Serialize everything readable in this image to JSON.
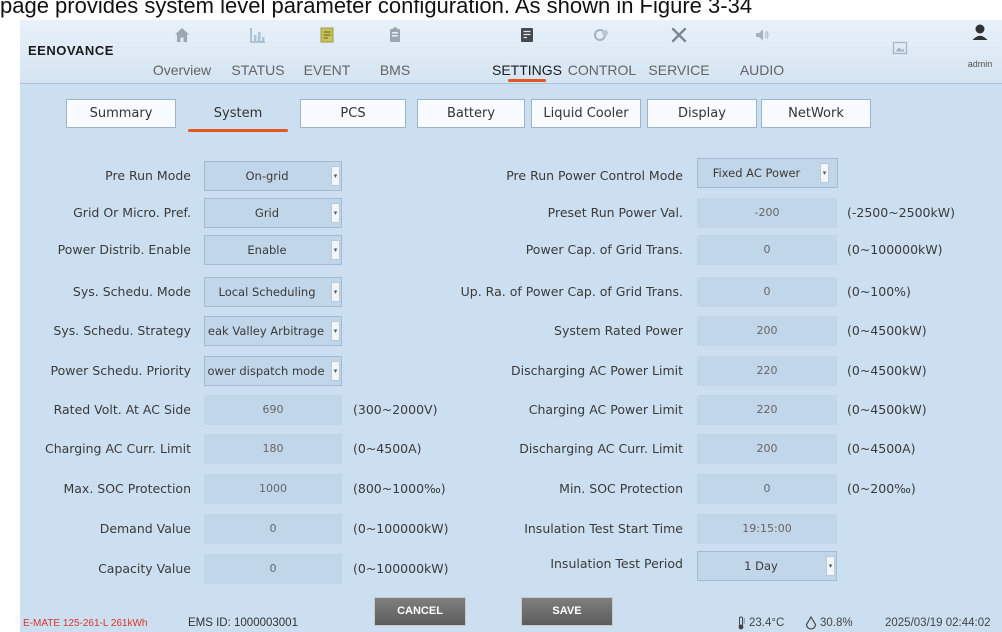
{
  "caption": "page provides system level parameter configuration. As shown in Figure 3-34",
  "logo": "EENOVANCE",
  "nav": [
    {
      "label": "Overview",
      "icon": "home-icon"
    },
    {
      "label": "STATUS",
      "icon": "bar-chart-icon"
    },
    {
      "label": "EVENT",
      "icon": "event-icon"
    },
    {
      "label": "BMS",
      "icon": "battery-icon"
    },
    {
      "label": "SETTINGS",
      "icon": "settings-doc-icon"
    },
    {
      "label": "CONTROL",
      "icon": "control-icon"
    },
    {
      "label": "SERVICE",
      "icon": "service-tools-icon"
    },
    {
      "label": "AUDIO",
      "icon": "speaker-icon"
    },
    {
      "label": "",
      "icon": "screenshot-icon"
    },
    {
      "label": "admin",
      "icon": "user-avatar-icon"
    }
  ],
  "tabs": [
    "Summary",
    "System",
    "PCS",
    "Battery",
    "Liquid Cooler",
    "Display",
    "NetWork"
  ],
  "left": [
    {
      "label": "Pre Run Mode",
      "value": "On-grid"
    },
    {
      "label": "Grid Or Micro. Pref.",
      "value": "Grid"
    },
    {
      "label": "Power Distrib. Enable",
      "value": "Enable"
    },
    {
      "label": "Sys. Schedu. Mode",
      "value": "Local Scheduling"
    },
    {
      "label": "Sys. Schedu. Strategy",
      "value": "eak Valley Arbitrage"
    },
    {
      "label": "Power Schedu. Priority",
      "value": "ower dispatch mode"
    },
    {
      "label": "Rated Volt. At AC Side",
      "value": "690",
      "range": "(300~2000V)"
    },
    {
      "label": "Charging AC Curr. Limit",
      "value": "180",
      "range": "(0~4500A)"
    },
    {
      "label": "Max. SOC Protection",
      "value": "1000",
      "range": "(800~1000‰)"
    },
    {
      "label": "Demand Value",
      "value": "0",
      "range": "(0~100000kW)"
    },
    {
      "label": "Capacity Value",
      "value": "0",
      "range": "(0~100000kW)"
    }
  ],
  "right": [
    {
      "label": "Pre Run Power Control Mode",
      "value": "Fixed AC Power"
    },
    {
      "label": "Preset Run Power Val.",
      "value": "-200",
      "range": "(-2500~2500kW)"
    },
    {
      "label": "Power Cap. of Grid Trans.",
      "value": "0",
      "range": "(0~100000kW)"
    },
    {
      "label": "Up. Ra. of Power Cap. of Grid Trans.",
      "value": "0",
      "range": "(0~100%)"
    },
    {
      "label": "System Rated Power",
      "value": "200",
      "range": "(0~4500kW)"
    },
    {
      "label": "Discharging AC Power Limit",
      "value": "220",
      "range": "(0~4500kW)"
    },
    {
      "label": "Charging AC Power Limit",
      "value": "220",
      "range": "(0~4500kW)"
    },
    {
      "label": "Discharging AC Curr. Limit",
      "value": "200",
      "range": "(0~4500A)"
    },
    {
      "label": "Min. SOC Protection",
      "value": "0",
      "range": "(0~200‰)"
    },
    {
      "label": "Insulation Test Start Time",
      "value": "19:15:00"
    },
    {
      "label": "Insulation Test Period",
      "value": "1 Day"
    }
  ],
  "footer": {
    "model": "E-MATE 125-261-L 261kWh",
    "ems_id": "EMS ID: 1000003001",
    "cancel": "CANCEL",
    "save": "SAVE",
    "temperature": "23.4°C",
    "humidity": "30.8%",
    "datetime": "2025/03/19 02:44:02"
  },
  "colors": {
    "accent": "#e3561f",
    "background": "#ccdff1",
    "model_text": "#d9352a"
  }
}
